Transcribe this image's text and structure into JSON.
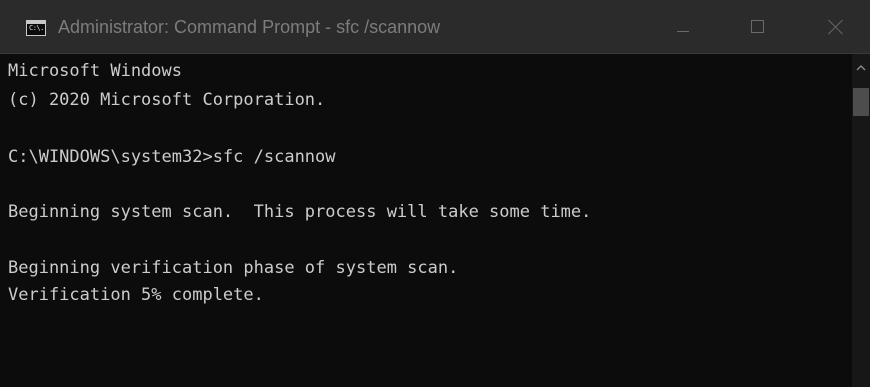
{
  "window": {
    "title": "Administrator: Command Prompt - sfc  /scannow",
    "icon_name": "cmd-icon",
    "icon_text": "C:\\."
  },
  "controls": {
    "minimize_icon": "minimize-icon",
    "maximize_icon": "maximize-icon",
    "close_icon": "close-icon"
  },
  "console": {
    "lines": [
      "Microsoft Windows",
      "(c) 2020 Microsoft Corporation.",
      "",
      "C:\\WINDOWS\\system32>sfc /scannow",
      "",
      "Beginning system scan.  This process will take some time.",
      "",
      "Beginning verification phase of system scan.",
      "Verification 5% complete."
    ]
  },
  "colors": {
    "background": "#0c0c0c",
    "text": "#cccccc",
    "titlebar": "#2b2b2b",
    "title_text": "#7c7c7c"
  }
}
